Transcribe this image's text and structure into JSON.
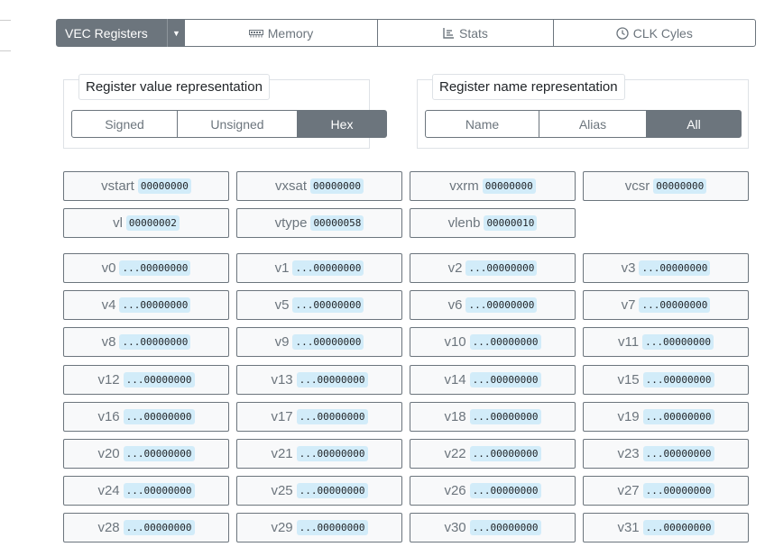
{
  "tabs": {
    "active_label": "VEC Registers",
    "items": [
      {
        "label": "Memory",
        "icon": "memory-icon"
      },
      {
        "label": "Stats",
        "icon": "chart-icon"
      },
      {
        "label": "CLK Cyles",
        "icon": "clock-icon"
      }
    ]
  },
  "value_repr": {
    "legend": "Register value representation",
    "options": [
      "Signed",
      "Unsigned",
      "Hex"
    ],
    "selected": "Hex"
  },
  "name_repr": {
    "legend": "Register name representation",
    "options": [
      "Name",
      "Alias",
      "All"
    ],
    "selected": "All"
  },
  "csr_registers": [
    {
      "name": "vstart",
      "value": "00000000"
    },
    {
      "name": "vxsat",
      "value": "00000000"
    },
    {
      "name": "vxrm",
      "value": "00000000"
    },
    {
      "name": "vcsr",
      "value": "00000000"
    },
    {
      "name": "vl",
      "value": "00000002"
    },
    {
      "name": "vtype",
      "value": "00000058"
    },
    {
      "name": "vlenb",
      "value": "00000010"
    }
  ],
  "vector_registers": [
    {
      "name": "v0",
      "value": "...00000000"
    },
    {
      "name": "v1",
      "value": "...00000000"
    },
    {
      "name": "v2",
      "value": "...00000000"
    },
    {
      "name": "v3",
      "value": "...00000000"
    },
    {
      "name": "v4",
      "value": "...00000000"
    },
    {
      "name": "v5",
      "value": "...00000000"
    },
    {
      "name": "v6",
      "value": "...00000000"
    },
    {
      "name": "v7",
      "value": "...00000000"
    },
    {
      "name": "v8",
      "value": "...00000000"
    },
    {
      "name": "v9",
      "value": "...00000000"
    },
    {
      "name": "v10",
      "value": "...00000000"
    },
    {
      "name": "v11",
      "value": "...00000000"
    },
    {
      "name": "v12",
      "value": "...00000000"
    },
    {
      "name": "v13",
      "value": "...00000000"
    },
    {
      "name": "v14",
      "value": "...00000000"
    },
    {
      "name": "v15",
      "value": "...00000000"
    },
    {
      "name": "v16",
      "value": "...00000000"
    },
    {
      "name": "v17",
      "value": "...00000000"
    },
    {
      "name": "v18",
      "value": "...00000000"
    },
    {
      "name": "v19",
      "value": "...00000000"
    },
    {
      "name": "v20",
      "value": "...00000000"
    },
    {
      "name": "v21",
      "value": "...00000000"
    },
    {
      "name": "v22",
      "value": "...00000000"
    },
    {
      "name": "v23",
      "value": "...00000000"
    },
    {
      "name": "v24",
      "value": "...00000000"
    },
    {
      "name": "v25",
      "value": "...00000000"
    },
    {
      "name": "v26",
      "value": "...00000000"
    },
    {
      "name": "v27",
      "value": "...00000000"
    },
    {
      "name": "v28",
      "value": "...00000000"
    },
    {
      "name": "v29",
      "value": "...00000000"
    },
    {
      "name": "v30",
      "value": "...00000000"
    },
    {
      "name": "v31",
      "value": "...00000000"
    }
  ]
}
